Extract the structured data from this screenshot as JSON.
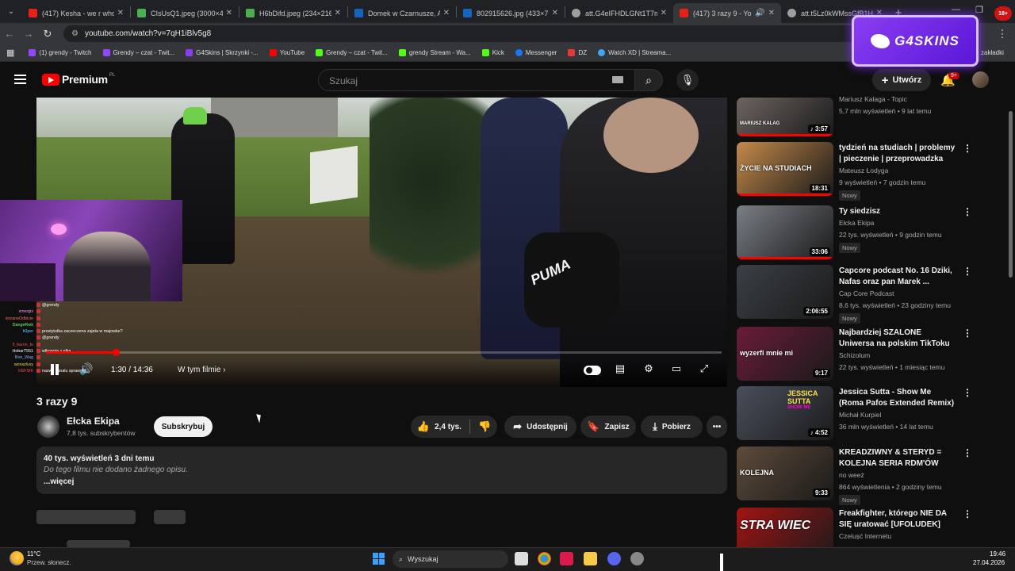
{
  "browser": {
    "tabs": [
      {
        "label": "(417) Kesha - we r who we",
        "color": "#e62117"
      },
      {
        "label": "CIsUsQ1.jpeg (3000×4000)",
        "color": "#4caf50"
      },
      {
        "label": "H6bDifd.jpeg (234×216)",
        "color": "#4caf50"
      },
      {
        "label": "Domek w Czarnusze, Aug",
        "color": "#1565c0"
      },
      {
        "label": "802915626.jpg (433×768)",
        "color": "#1565c0"
      },
      {
        "label": "att.G4eIFHDLGNt1T7mvL",
        "color": "#9e9e9e"
      },
      {
        "label": "(417) 3 razy 9 - YouTu",
        "color": "#e62117"
      },
      {
        "label": "att.t5Lz0kWMssGfB1H90",
        "color": "#9e9e9e"
      }
    ],
    "url": "youtube.com/watch?v=7qH1iBlv5g8",
    "bookmarks": [
      {
        "label": "(1) grendy - Twitch",
        "color": "#9146ff"
      },
      {
        "label": "Grendy – czat - Twit...",
        "color": "#9146ff"
      },
      {
        "label": "G4Skins | Skrzynki -...",
        "color": "#8a3df3"
      },
      {
        "label": "YouTube",
        "color": "#ff0000"
      },
      {
        "label": "Grendy – czat - Twit...",
        "color": "#53fc18"
      },
      {
        "label": "grendy Stream - Wa...",
        "color": "#53fc18"
      },
      {
        "label": "Kick",
        "color": "#53fc18"
      },
      {
        "label": "Messenger",
        "color": "#1877f2"
      },
      {
        "label": "DZ",
        "color": "#e53935"
      },
      {
        "label": "Watch XD | Streama...",
        "color": "#42a5f5"
      }
    ],
    "bookmarks_more": "zakładki"
  },
  "header": {
    "logo": "Premium",
    "logo_cc": "PL",
    "search_placeholder": "Szukaj",
    "create_label": "Utwórz",
    "bell_badge": "9+"
  },
  "overlay": {
    "brand": "G4SKINS",
    "age": "18+"
  },
  "chat": [
    {
      "name": "",
      "msg": "@grendy",
      "color": "#aaaaaa"
    },
    {
      "name": "xmergix",
      "msg": "",
      "color": "#ff8cf0"
    },
    {
      "name": "strzaneOdbicie",
      "msg": "",
      "color": "#ff6666"
    },
    {
      "name": "DangeReik",
      "msg": "",
      "color": "#7cff7c"
    },
    {
      "name": "k0per",
      "msg": "prostytutka zaczeczena zajeta w majowke?",
      "color": "#66ccff"
    },
    {
      "name": "",
      "msg": "@grendy",
      "color": "#aaaaaa"
    },
    {
      "name": "Il_baron_tu",
      "msg": "",
      "color": "#ff4f4f"
    },
    {
      "name": "HobarT551",
      "msg": "wlkowyje z elka",
      "color": "#ffffff"
    },
    {
      "name": "Bon_Wag",
      "msg": "",
      "color": "#7fb2ff"
    },
    {
      "name": "wonszlvsy",
      "msg": "",
      "color": "#ffd24a"
    },
    {
      "name": "KEFSIK",
      "msg": "nazwe kanalu sprawdz",
      "color": "#ff4f4f"
    }
  ],
  "player": {
    "time": "1:30 / 14:36",
    "chapter": "W tym filmie",
    "progress": 0.103,
    "brand_text": "PUMA"
  },
  "video": {
    "title": "3 razy 9",
    "channel": "Ełcka Ekipa",
    "subscribers": "7,8 tys. subskrybentów",
    "subscribe_label": "Subskrybuj",
    "likes": "2,4 tys.",
    "share_label": "Udostępnij",
    "save_label": "Zapisz",
    "download_label": "Pobierz",
    "desc_meta": "40 tys. wyświetleń  3 dni temu",
    "desc_text": "Do tego filmu nie dodano żadnego opisu.",
    "desc_more": "...więcej"
  },
  "sidebar": [
    {
      "title": "",
      "channel": "Mariusz Kalaga - Topic",
      "stats": "5,7 mln wyświetleń • 9 lat temu",
      "duration": "3:57",
      "music": true,
      "new": "",
      "thumb": "#6d6460"
    },
    {
      "title": "tydzień na studiach | problemy | pieczenie | przeprowadzka",
      "channel": "Mateusz Łodyga",
      "stats": "9 wyświetleń • 7 godzin temu",
      "duration": "18:31",
      "music": false,
      "new": "Nowy",
      "thumb": "#c58a4a"
    },
    {
      "title": "Ty siedzisz",
      "channel": "Ełcka Ekipa",
      "stats": "22 tys. wyświetleń • 9 godzin temu",
      "duration": "33:06",
      "music": false,
      "new": "Nowy",
      "thumb": "#7a7f86"
    },
    {
      "title": "Capcore podcast No. 16 Dziki, Nafas oraz pan Marek ...",
      "channel": "Cap Core Podcast",
      "stats": "8,6 tys. wyświetleń • 23 godziny temu",
      "duration": "2:06:55",
      "music": false,
      "new": "Nowy",
      "thumb": "#3b4046"
    },
    {
      "title": "Najbardziej SZALONE Uniwersa na polskim TikToku",
      "channel": "Schizolum",
      "stats": "22 tys. wyświetleń • 1 miesiąc temu",
      "duration": "9:17",
      "music": false,
      "new": "",
      "thumb": "#6b1b3a"
    },
    {
      "title": "Jessica Sutta - Show Me (Roma Pafos Extended Remix)",
      "channel": "Michał Kurpiel",
      "stats": "36 mln wyświetleń • 14 lat temu",
      "duration": "4:52",
      "music": true,
      "new": "",
      "thumb": "#4a4f5c"
    },
    {
      "title": "KREADZIWNY & STERYD = KOLEJNA SERIA RDM'ÓW",
      "channel": "no weeź",
      "stats": "864 wyświetlenia • 2 godziny temu",
      "duration": "9:33",
      "music": false,
      "new": "Nowy",
      "thumb": "#5e4b3a"
    },
    {
      "title": "Freakfighter, którego NIE DA SIĘ uratować [UFOLUDEK]",
      "channel": "Czelușć Internetu",
      "stats": "",
      "duration": "",
      "music": false,
      "new": "",
      "thumb": "#a31313"
    }
  ],
  "thumb_texts": {
    "t1": "MARIUSZ KALAG",
    "t2": "ŻYCIE NA STUDIACH",
    "t5": "wyzerfi mnie mi",
    "t6a": "JESSICA",
    "t6b": "SUTTA",
    "t6c": "SHOW ME",
    "t7": "KOLEJNA",
    "t8": "STRA    WIEC"
  },
  "taskbar": {
    "temp": "11°C",
    "weather": "Przew. słonecz.",
    "search": "Wyszukaj",
    "time": "19:46",
    "date": "27.04.2026"
  }
}
